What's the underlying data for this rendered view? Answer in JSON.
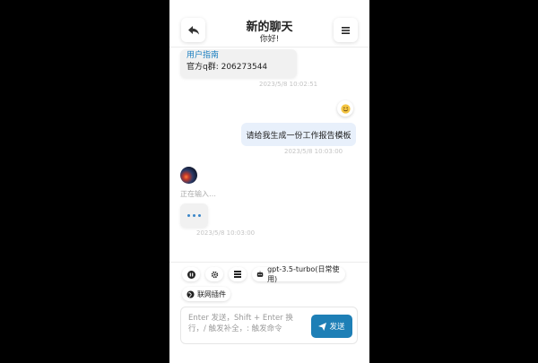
{
  "header": {
    "title": "新的聊天",
    "subtitle": "你好!",
    "back_icon": "reply-icon",
    "menu_icon": "hamburger-icon"
  },
  "messages": {
    "bot1": {
      "link_text": "用户指南",
      "line2": "官方q群: 206273544",
      "timestamp": "2023/5/8 10:02:51"
    },
    "emoji_icon": "smile-emoji-icon",
    "user1": {
      "text": "请给我生成一份工作报告模板",
      "timestamp": "2023/5/8 10:03:00"
    },
    "typing": {
      "label": "正在输入…",
      "timestamp": "2023/5/8 10:03:00"
    }
  },
  "toolbar": {
    "model_label": "gpt-3.5-turbo(日常使用)",
    "plugin_label": "联网插件"
  },
  "input": {
    "placeholder": "Enter 发送，Shift + Enter 换行，/ 触发补全，: 触发命令",
    "send_label": "发送"
  },
  "colors": {
    "accent": "#1e7fb6",
    "user_bubble": "#e8f0fb",
    "link": "#1c7fc0"
  }
}
